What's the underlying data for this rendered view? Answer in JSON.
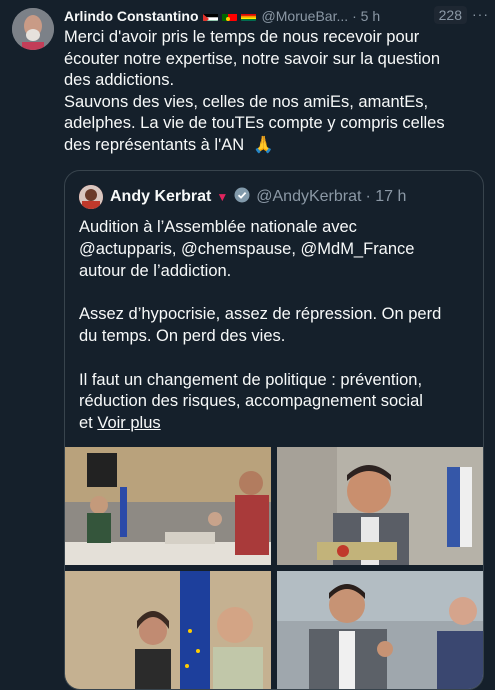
{
  "tweet": {
    "author_name": "Arlindo Constantino",
    "handle": "@MorueBar...",
    "time": "· 5 h",
    "count": "228",
    "more_icon": "···",
    "text": "Merci d'avoir pris le temps de nous recevoir pour\nécouter notre expertise, notre savoir sur la question\ndes addictions.\nSauvons des vies, celles de nos amiEs, amantEs,\nadelphes. La vie de touTEs compte y compris celles\ndes représentants à l'AN  🙏"
  },
  "quote": {
    "author_name": "Andy Kerbrat",
    "handle": "@AndyKerbrat",
    "time": "· 17 h",
    "text": "Audition à l’Assemblée nationale avec\n@actupparis, @chemspause, @MdM_France\nautour de l’addiction.\n\nAssez d’hypocrisie, assez de répression. On perd\ndu temps. On perd des vies.\n\nIl faut un changement de politique : prévention,\nréduction des risques, accompagnement social\net ",
    "show_more": "Voir plus"
  },
  "colors": {
    "background": "#15202b",
    "text": "#f7f9f9",
    "secondary": "#8b98a5",
    "border": "#38444d"
  }
}
